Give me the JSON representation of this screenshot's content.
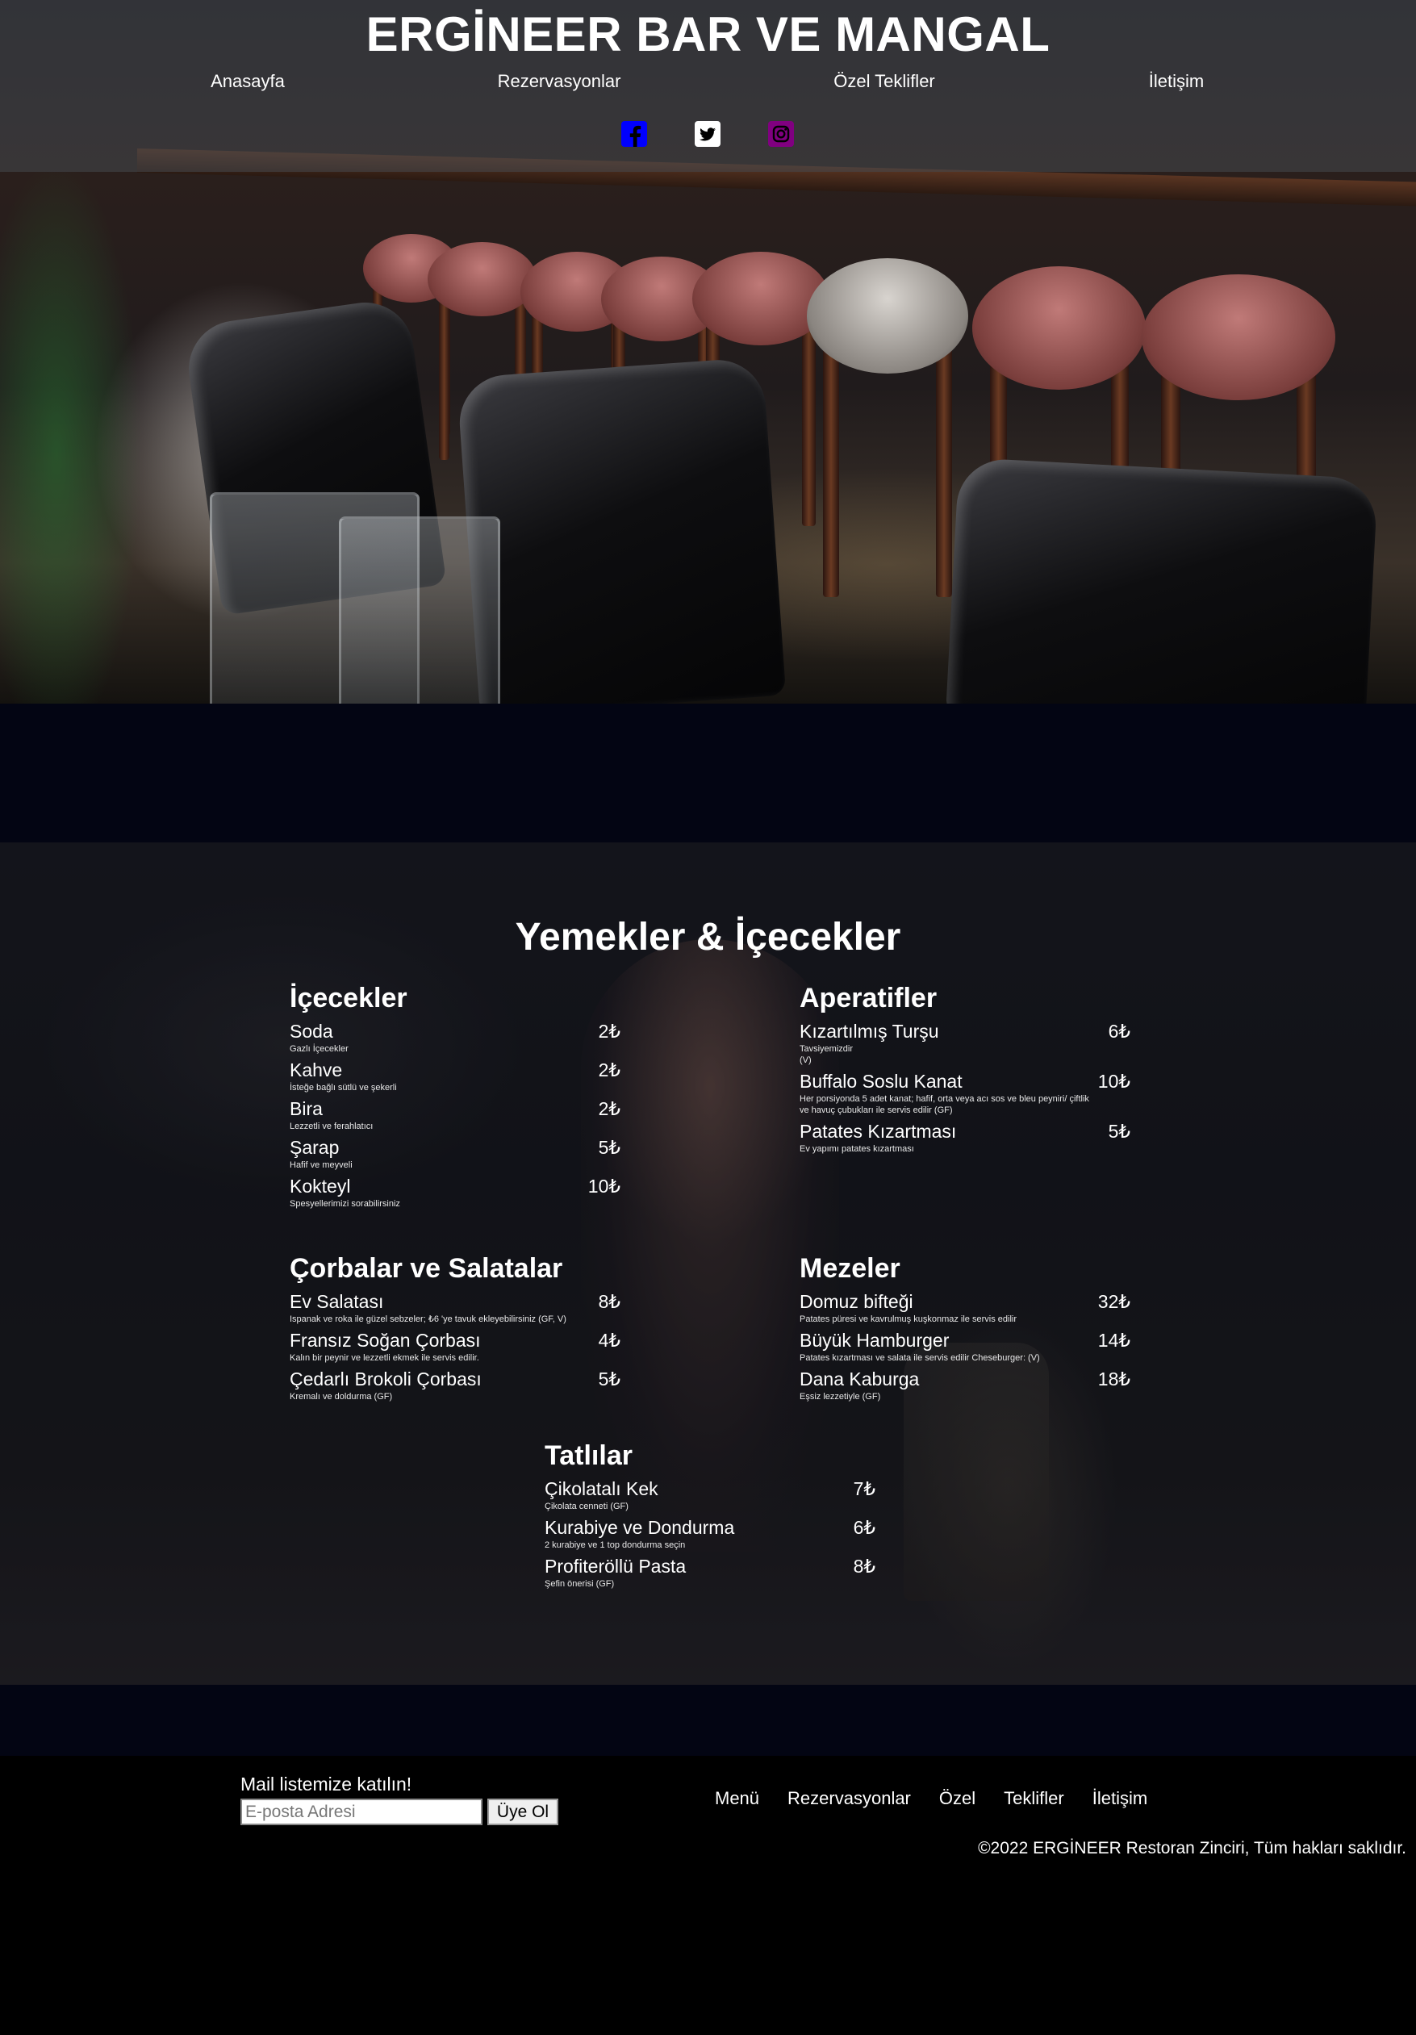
{
  "header": {
    "site_title": "ERGİNEER BAR VE MANGAL",
    "nav": [
      {
        "label": "Anasayfa"
      },
      {
        "label": "Rezervasyonlar"
      },
      {
        "label": "Özel Teklifler"
      },
      {
        "label": "İletişim"
      }
    ],
    "socials": [
      {
        "icon": "facebook-icon",
        "color": "#0000ff"
      },
      {
        "icon": "twitter-icon",
        "color": "#ffffff"
      },
      {
        "icon": "instagram-icon",
        "color": "#800080"
      }
    ]
  },
  "menu": {
    "title": "Yemekler & İçecekler",
    "categories": [
      {
        "title": "İçecekler",
        "items": [
          {
            "name": "Soda",
            "price": "2₺",
            "desc": "Gazlı İçecekler"
          },
          {
            "name": "Kahve",
            "price": "2₺",
            "desc": "İsteğe bağlı sütlü ve şekerli"
          },
          {
            "name": "Bira",
            "price": "2₺",
            "desc": "Lezzetli ve ferahlatıcı"
          },
          {
            "name": "Şarap",
            "price": "5₺",
            "desc": "Hafif ve meyveli"
          },
          {
            "name": "Kokteyl",
            "price": "10₺",
            "desc": "Spesyellerimizi sorabilirsiniz"
          }
        ]
      },
      {
        "title": "Aperatifler",
        "items": [
          {
            "name": "Kızartılmış Turşu",
            "price": "6₺",
            "desc": "Tavsiyemizdir\n(V)"
          },
          {
            "name": "Buffalo Soslu Kanat",
            "price": "10₺",
            "desc": "Her porsiyonda 5 adet kanat; hafif, orta veya acı sos ve bleu peyniri/ çiftlik ve havuç çubukları ile servis edilir (GF)"
          },
          {
            "name": "Patates Kızartması",
            "price": "5₺",
            "desc": "Ev yapımı patates kızartması"
          }
        ]
      },
      {
        "title": "Çorbalar ve Salatalar",
        "items": [
          {
            "name": "Ev Salatası",
            "price": "8₺",
            "desc": "Ispanak ve roka ile güzel sebzeler; ₺6 'ye tavuk ekleyebilirsiniz (GF, V)"
          },
          {
            "name": "Fransız Soğan Çorbası",
            "price": "4₺",
            "desc": "Kalın bir peynir ve lezzetli ekmek ile servis edilir."
          },
          {
            "name": "Çedarlı Brokoli Çorbası",
            "price": "5₺",
            "desc": "Kremalı ve doldurma (GF)"
          }
        ]
      },
      {
        "title": "Mezeler",
        "items": [
          {
            "name": "Domuz bifteği",
            "price": "32₺",
            "desc": "Patates püresi ve kavrulmuş kuşkonmaz ile servis edilir"
          },
          {
            "name": "Büyük Hamburger",
            "price": "14₺",
            "desc": "Patates kızartması ve salata ile servis edilir Cheseburger: (V)"
          },
          {
            "name": "Dana Kaburga",
            "price": "18₺",
            "desc": "Eşsiz lezzetiyle (GF)"
          }
        ]
      },
      {
        "title": "Tatlılar",
        "items": [
          {
            "name": "Çikolatalı Kek",
            "price": "7₺",
            "desc": "Çikolata cenneti (GF)"
          },
          {
            "name": "Kurabiye ve Dondurma",
            "price": "6₺",
            "desc": "2 kurabiye ve 1 top dondurma seçin"
          },
          {
            "name": "Profiteröllü Pasta",
            "price": "8₺",
            "desc": "Şefin önerisi (GF)"
          }
        ]
      }
    ]
  },
  "footer": {
    "mail_label": "Mail listemize katılın!",
    "email_placeholder": "E-posta Adresi",
    "signup_label": "Üye Ol",
    "links": [
      {
        "label": "Menü"
      },
      {
        "label": "Rezervasyonlar"
      },
      {
        "label": "Özel"
      },
      {
        "label": "Teklifler"
      },
      {
        "label": "İletişim"
      }
    ],
    "copyright": "©2022 ERGİNEER Restoran Zinciri, Tüm hakları saklıdır."
  }
}
